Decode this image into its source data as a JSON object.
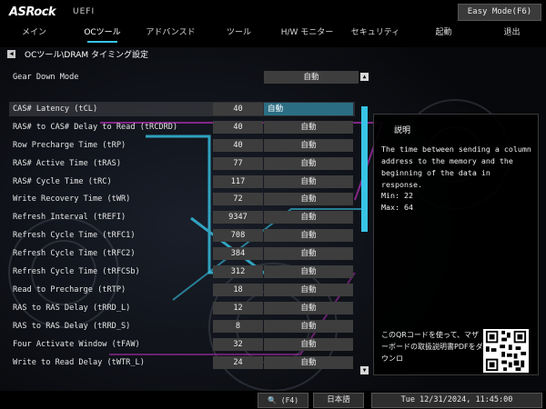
{
  "brand": {
    "logo": "ASRock",
    "sub": "UEFI"
  },
  "easy_mode_label": "Easy Mode(F6)",
  "nav": [
    {
      "label": "メイン"
    },
    {
      "label": "OCツール"
    },
    {
      "label": "アドバンスド"
    },
    {
      "label": "ツール"
    },
    {
      "label": "H/W モニター"
    },
    {
      "label": "セキュリティ"
    },
    {
      "label": "起動"
    },
    {
      "label": "退出"
    }
  ],
  "active_tab": "OCツール",
  "breadcrumb": "OCツール\\DRAM タイミング設定",
  "gear_down": {
    "label": "Gear Down Mode",
    "value": "自動"
  },
  "rows": [
    {
      "label": "CAS# Latency (tCL)",
      "value": "40",
      "setting": "自動"
    },
    {
      "label": "RAS# to CAS# Delay to Read  (tRCDRD)",
      "value": "40",
      "setting": "自動"
    },
    {
      "label": "Row Precharge Time (tRP)",
      "value": "40",
      "setting": "自動"
    },
    {
      "label": "RAS# Active Time (tRAS)",
      "value": "77",
      "setting": "自動"
    },
    {
      "label": "RAS# Cycle Time (tRC)",
      "value": "117",
      "setting": "自動"
    },
    {
      "label": "Write Recovery Time (tWR)",
      "value": "72",
      "setting": "自動"
    },
    {
      "label": "Refresh Interval (tREFI)",
      "value": "9347",
      "setting": "自動"
    },
    {
      "label": "Refresh Cycle Time (tRFC1)",
      "value": "708",
      "setting": "自動"
    },
    {
      "label": "Refresh Cycle Time (tRFC2)",
      "value": "384",
      "setting": "自動"
    },
    {
      "label": "Refresh Cycle Time (tRFCSb)",
      "value": "312",
      "setting": "自動"
    },
    {
      "label": "Read to Precharge (tRTP)",
      "value": "18",
      "setting": "自動"
    },
    {
      "label": "RAS to RAS Delay (tRRD_L)",
      "value": "12",
      "setting": "自動"
    },
    {
      "label": "RAS to RAS Delay (tRRD_S)",
      "value": "8",
      "setting": "自動"
    },
    {
      "label": "Four Activate Window (tFAW)",
      "value": "32",
      "setting": "自動"
    },
    {
      "label": "Write to Read Delay (tWTR_L)",
      "value": "24",
      "setting": "自動"
    }
  ],
  "description": {
    "title": "説明",
    "body": "The time between sending a column address to the memory and the beginning of the data in response.",
    "min": "Min: 22",
    "max": "Max: 64",
    "qr_text": "このQRコードを使って、マザーボードの取扱説明書PDFをダウンロ"
  },
  "footer": {
    "search_label": "(F4)",
    "language": "日本語",
    "datetime": "Tue 12/31/2024, 11:45:00"
  },
  "colors": {
    "accent": "#38c4e6",
    "active_select": "#2b6e84",
    "field": "#3d3d3d"
  }
}
